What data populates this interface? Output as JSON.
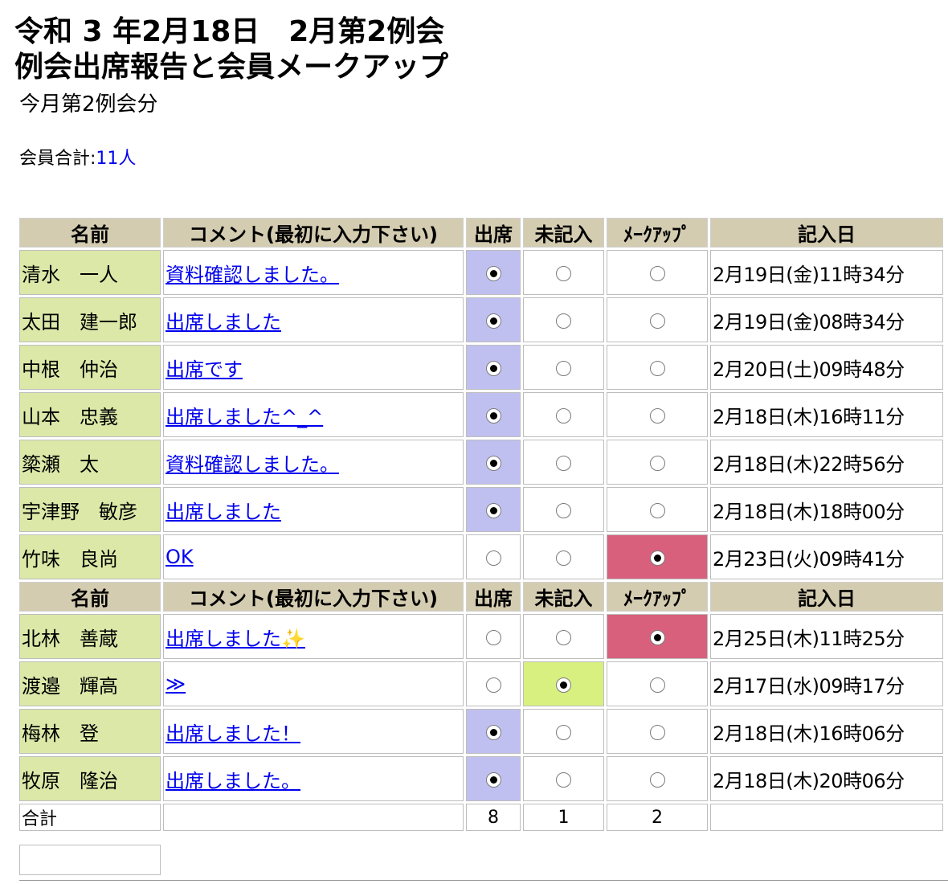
{
  "header": {
    "title1": "令和 3 年2月18日　2月第2例会",
    "title2": "例会出席報告と会員メークアップ",
    "subtitle": "今月第2例会分",
    "member_total_label": "会員合計:",
    "member_total_value": "11人"
  },
  "columns": [
    "名前",
    "コメント(最初に入力下さい)",
    "出席",
    "未記入",
    "ﾒｰｸｱｯﾌﾟ",
    "記入日"
  ],
  "rows_group1": [
    {
      "name": "清水　一人",
      "comment": "資料確認しました。",
      "status": "attend",
      "date": "2月19日(金)11時34分"
    },
    {
      "name": "太田　建一郎",
      "comment": "出席しました",
      "status": "attend",
      "date": "2月19日(金)08時34分"
    },
    {
      "name": "中根　仲治",
      "comment": "出席です",
      "status": "attend",
      "date": "2月20日(土)09時48分"
    },
    {
      "name": "山本　忠義",
      "comment": "出席しました^_^",
      "status": "attend",
      "date": "2月18日(木)16時11分"
    },
    {
      "name": "簗瀬　太",
      "comment": "資料確認しました。",
      "status": "attend",
      "date": "2月18日(木)22時56分"
    },
    {
      "name": "宇津野　敏彦",
      "comment": "出席しました",
      "status": "attend",
      "date": "2月18日(木)18時00分"
    },
    {
      "name": "竹味　良尚",
      "comment": "OK",
      "status": "makeup",
      "date": "2月23日(火)09時41分"
    }
  ],
  "rows_group2": [
    {
      "name": "北林　善蔵",
      "comment": "出席しました✨",
      "status": "makeup",
      "date": "2月25日(木)11時25分"
    },
    {
      "name": "渡邉　輝高",
      "comment": "≫",
      "status": "unrecorded",
      "date": "2月17日(水)09時17分"
    },
    {
      "name": "梅林　登",
      "comment": "出席しました！",
      "status": "attend",
      "date": "2月18日(木)16時06分"
    },
    {
      "name": "牧原　隆治",
      "comment": "出席しました。",
      "status": "attend",
      "date": "2月18日(木)20時06分"
    }
  ],
  "totals": {
    "label": "合計",
    "attend": "8",
    "unrecorded": "1",
    "makeup": "2"
  },
  "colors": {
    "header_bg": "#d4ccb0",
    "name_bg": "#dce8a8",
    "attend_bg": "#c0c0f0",
    "unrecorded_bg": "#d8f080",
    "makeup_bg": "#d8607c",
    "link": "#0000ee"
  }
}
